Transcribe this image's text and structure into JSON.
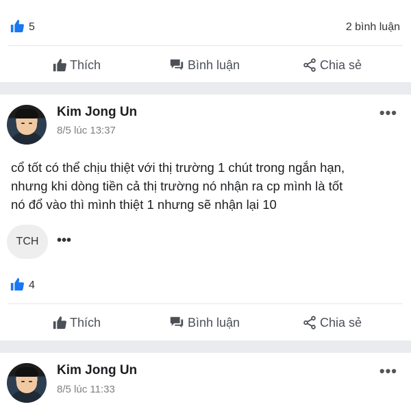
{
  "post_prev": {
    "like_count": "5",
    "comment_count": "2 bình luận"
  },
  "actions": {
    "like": "Thích",
    "comment": "Bình luận",
    "share": "Chia sẻ"
  },
  "post_main": {
    "author": "Kim Jong Un",
    "time": "8/5 lúc 13:37",
    "text_lines": [
      "cổ tốt có thể chịu thiệt với thị trường 1 chút trong ngắn hạn,",
      "nhưng khi dòng tiền cả thị trường nó nhận ra cp mình là tốt",
      "nó đổ vào thì mình thiệt 1 nhưng sẽ nhận lại 10"
    ],
    "tag": "TCH",
    "tag_more": "•••",
    "like_count": "4"
  },
  "post_next": {
    "author": "Kim Jong Un",
    "time": "8/5 lúc 11:33"
  },
  "more_menu": "•••",
  "colors": {
    "accent": "#1877f2",
    "band": "#e9ebee",
    "icon": "#4b4f56"
  }
}
